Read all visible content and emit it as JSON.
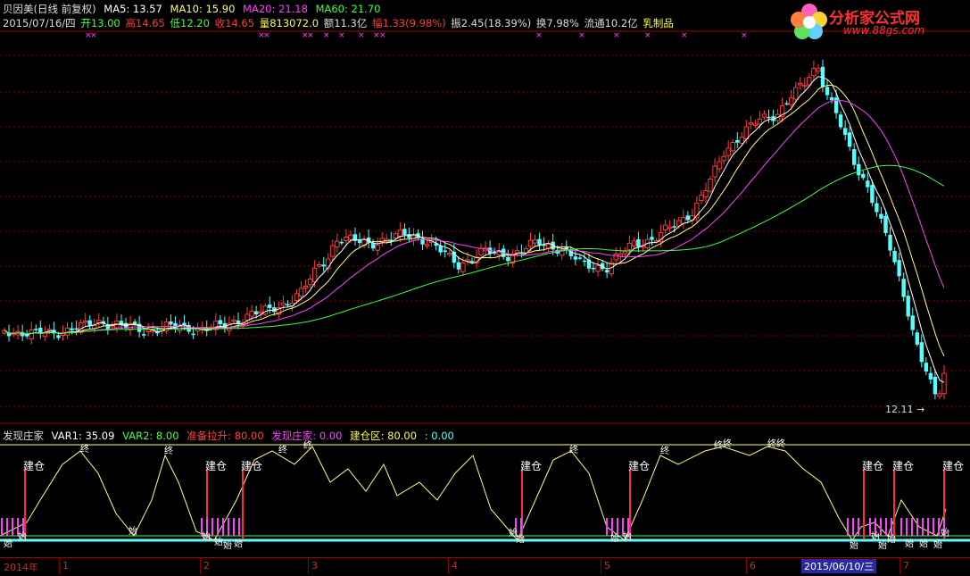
{
  "header": {
    "stock_name": "贝因美(日线 前复权)",
    "ma5": "MA5: 13.57",
    "ma10": "MA10: 15.90",
    "ma20": "MA20: 21.18",
    "ma60": "MA60: 21.70",
    "date": "2015/07/16/四",
    "open": "开13.00",
    "high": "高14.65",
    "low": "低12.20",
    "close": "收14.65",
    "volume": "量813072.0",
    "amount": "额11.3亿",
    "change": "幅1.33(9.98%)",
    "amplitude": "振2.45(18.39%)",
    "turnover": "换7.98%",
    "float": "流通10.2亿",
    "industry": "乳制品"
  },
  "logo": {
    "title": "分析家公式网",
    "url": "www.88gs.com"
  },
  "indicator": {
    "name": "发现庄家",
    "var1": "VAR1: 35.09",
    "var2": "VAR2: 8.00",
    "prep": "准备拉升: 80.00",
    "discover": "发现庄家: 0.00",
    "build": "建仓区: 80.00",
    "extra": ": 0.00",
    "label_build": "建仓",
    "label_top": "终",
    "label_start": "始"
  },
  "price_tag": "12.11",
  "axis": {
    "year": "2014年",
    "months": [
      "1",
      "2",
      "3",
      "4",
      "5",
      "6",
      "7"
    ],
    "selected_date": "2015/06/10/三"
  },
  "colors": {
    "up": "#ff3b3b",
    "down": "#54ffff",
    "ma5": "#ffffff",
    "ma10": "#ffff80",
    "ma20": "#ff40ff",
    "ma60": "#40ff40",
    "grid": "#800000"
  }
}
